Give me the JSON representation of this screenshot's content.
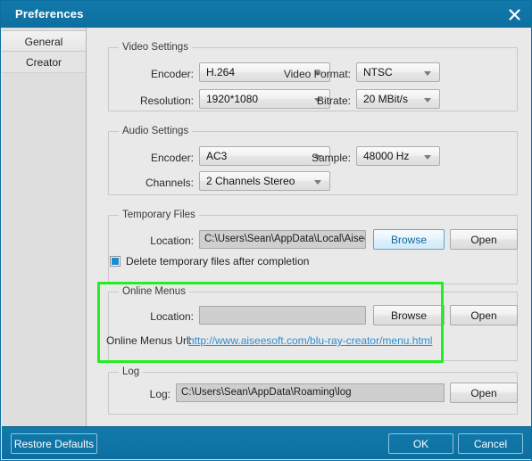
{
  "window": {
    "title": "Preferences",
    "close_icon": "close-icon"
  },
  "sidebar": {
    "items": [
      {
        "label": "General",
        "selected": true
      },
      {
        "label": "Creator",
        "selected": false
      }
    ]
  },
  "video_settings": {
    "group_title": "Video Settings",
    "encoder_label": "Encoder:",
    "encoder_value": "H.264",
    "video_format_label": "Video Format:",
    "video_format_value": "NTSC",
    "resolution_label": "Resolution:",
    "resolution_value": "1920*1080",
    "bitrate_label": "Bitrate:",
    "bitrate_value": "20 MBit/s"
  },
  "audio_settings": {
    "group_title": "Audio Settings",
    "encoder_label": "Encoder:",
    "encoder_value": "AC3",
    "sample_label": "Sample:",
    "sample_value": "48000 Hz",
    "channels_label": "Channels:",
    "channels_value": "2 Channels Stereo"
  },
  "temporary_files": {
    "group_title": "Temporary Files",
    "location_label": "Location:",
    "location_value": "C:\\Users\\Sean\\AppData\\Local\\Aiseesoft Studio\\A",
    "browse_label": "Browse",
    "open_label": "Open",
    "delete_checkbox_label": "Delete temporary files after completion",
    "delete_checkbox_checked": true
  },
  "online_menus": {
    "group_title": "Online Menus",
    "location_label": "Location:",
    "location_value": "",
    "browse_label": "Browse",
    "open_label": "Open",
    "url_label": "Online Menus Url:",
    "url_value": "http://www.aiseesoft.com/blu-ray-creator/menu.html"
  },
  "log": {
    "group_title": "Log",
    "log_label": "Log:",
    "log_value": "C:\\Users\\Sean\\AppData\\Roaming\\log",
    "open_label": "Open"
  },
  "footer": {
    "restore_defaults_label": "Restore Defaults",
    "ok_label": "OK",
    "cancel_label": "Cancel"
  },
  "colors": {
    "titlebar": "#0f74a5",
    "highlight": "#22ee22",
    "link": "#2b8fd6",
    "accent": "#1e8ad0"
  }
}
